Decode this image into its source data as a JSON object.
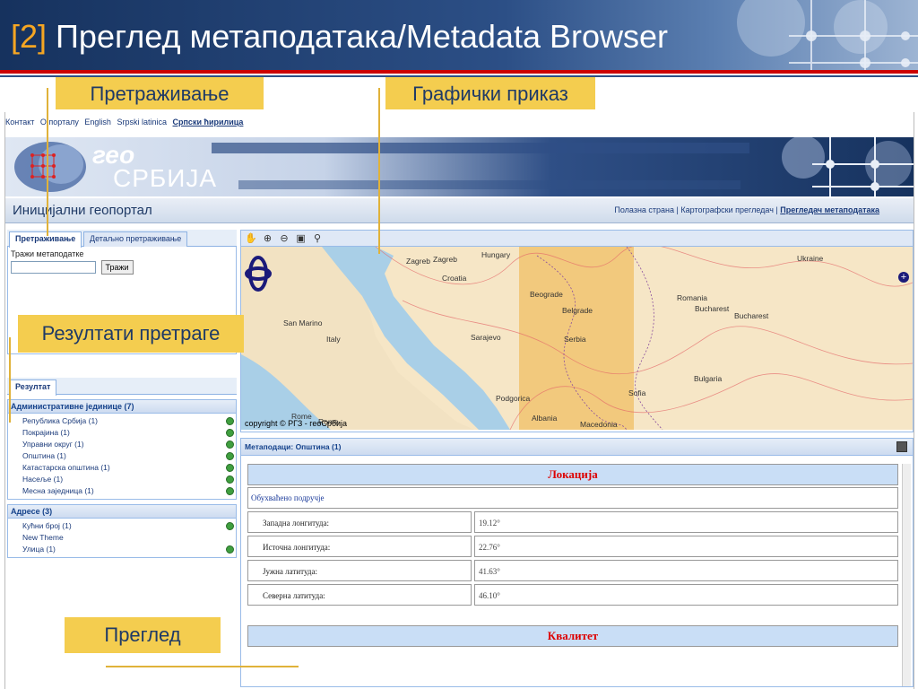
{
  "slide": {
    "number": "[2]",
    "title": "Преглед метаподатака/Metadata Browser"
  },
  "callouts": {
    "search": "Претраживање",
    "map": "Графички приказ",
    "results": "Резултати претраге",
    "review": "Преглед"
  },
  "portal": {
    "topnav": [
      "Контакт",
      "О порталу",
      "English",
      "Srpski latinica",
      "Српски ћирилица"
    ],
    "logo_geo": "гео",
    "logo_srb": "СРБИЈА",
    "title": "Иницијални геопортал",
    "links": [
      "Полазна страна",
      "Картографски прегледач",
      "Прегледач метаподатака"
    ],
    "tabs": [
      "Претраживање",
      "Детаљно претраживање"
    ],
    "search_label": "Тражи метаподатке",
    "search_value": "",
    "search_button": "Тражи",
    "result_tab": "Резултат",
    "groups": [
      {
        "title": "Административне јединице (7)",
        "items": [
          "Република Србија (1)",
          "Покрајина (1)",
          "Управни округ (1)",
          "Општина (1)",
          "Катастарска општина (1)",
          "Насеље (1)",
          "Месна заједница (1)"
        ]
      },
      {
        "title": "Адресе (3)",
        "items": [
          "Кућни број (1)",
          "New Theme",
          "Улица (1)"
        ]
      }
    ],
    "map": {
      "places": [
        "Hungary",
        "Zagreb",
        "Zagreb",
        "Ukraine",
        "Croatia",
        "Beograde",
        "Belgrade",
        "Romania",
        "Bucharest",
        "Bucharest",
        "San Marino",
        "Sarajevo",
        "Serbia",
        "Italy",
        "Bulgaria",
        "Podgorica",
        "Sofia",
        "Rome",
        "Rome",
        "Albania",
        "Macedonia"
      ],
      "copyright": "copyright © РГЗ - геоСрбија"
    },
    "meta": {
      "header": "Метаподаци: Општина (1)",
      "location_title": "Локација",
      "area_label": "Обухваћено подручје",
      "rows": [
        {
          "k": "Западна лонгитуда:",
          "v": "19.12°"
        },
        {
          "k": "Источна лонгитуда:",
          "v": "22.76°"
        },
        {
          "k": "Јужна латитуда:",
          "v": "41.63°"
        },
        {
          "k": "Северна латитуда:",
          "v": "46.10°"
        }
      ],
      "quality_title": "Квалитет"
    }
  }
}
